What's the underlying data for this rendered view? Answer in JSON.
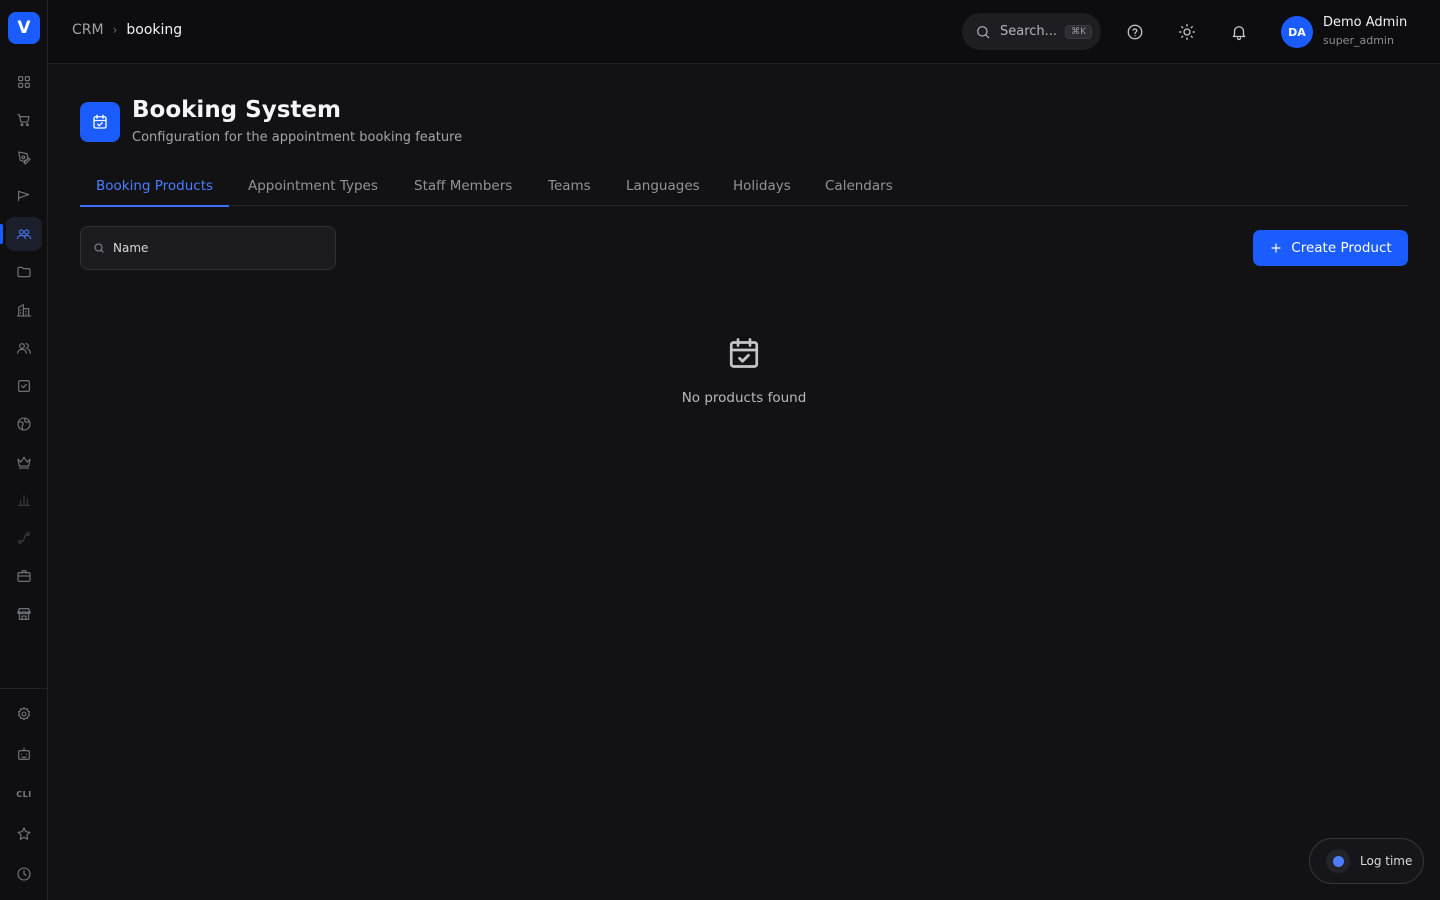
{
  "sidebar": {
    "logo_letter": "V",
    "items": [
      {
        "icon": "dashboard-grid-icon"
      },
      {
        "icon": "shopping-cart-icon"
      },
      {
        "icon": "pen-tool-icon"
      },
      {
        "icon": "megaphone-icon"
      },
      {
        "icon": "users-icon",
        "active": true
      },
      {
        "icon": "folder-icon"
      },
      {
        "icon": "building-icon"
      },
      {
        "icon": "contacts-icon"
      },
      {
        "icon": "checkbox-icon"
      },
      {
        "icon": "globe-icon"
      },
      {
        "icon": "crown-icon"
      },
      {
        "icon": "bar-chart-icon"
      },
      {
        "icon": "route-icon"
      },
      {
        "icon": "briefcase-icon"
      },
      {
        "icon": "store-icon"
      }
    ],
    "bottom_items": [
      {
        "icon": "settings-icon"
      },
      {
        "icon": "robot-icon"
      },
      {
        "icon": "cli-icon",
        "label": "CLI"
      },
      {
        "icon": "star-icon"
      },
      {
        "icon": "clock-icon"
      }
    ]
  },
  "breadcrumb": {
    "root": "CRM",
    "current": "booking"
  },
  "topbar": {
    "search_placeholder": "Search...",
    "search_shortcut": "⌘K",
    "user_initials": "DA",
    "user_name": "Demo Admin",
    "user_role": "super_admin"
  },
  "page": {
    "title": "Booking System",
    "subtitle": "Configuration for the appointment booking feature"
  },
  "tabs": [
    {
      "label": "Booking Products",
      "active": true
    },
    {
      "label": "Appointment Types"
    },
    {
      "label": "Staff Members"
    },
    {
      "label": "Teams"
    },
    {
      "label": "Languages"
    },
    {
      "label": "Holidays"
    },
    {
      "label": "Calendars"
    }
  ],
  "filter": {
    "placeholder": "Name",
    "value": ""
  },
  "actions": {
    "create_label": "Create Product"
  },
  "empty_state": {
    "message": "No products found"
  },
  "log_time": {
    "label": "Log time"
  },
  "colors": {
    "accent": "#1a5cff",
    "background": "#121214",
    "topbar": "#0d0d0f",
    "tab_active": "#4d7dff"
  }
}
